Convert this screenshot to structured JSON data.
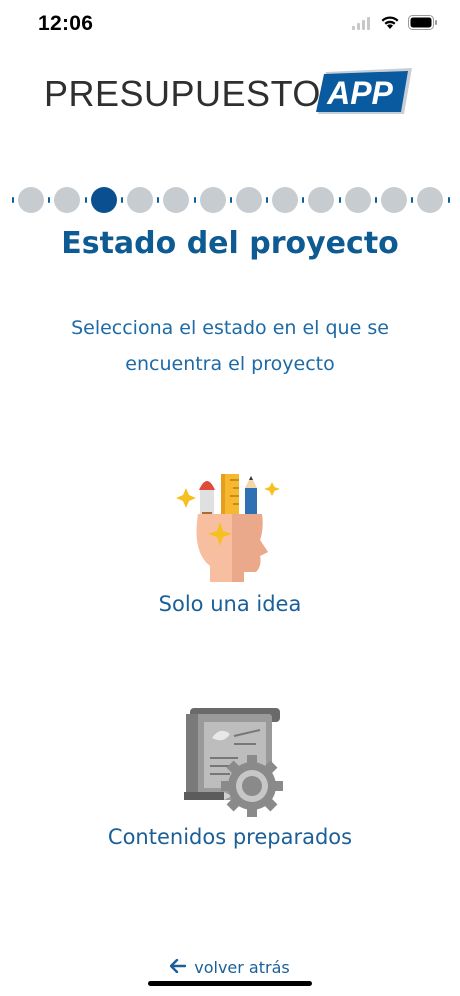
{
  "status_bar": {
    "time": "12:06",
    "icons": [
      "signal-icon",
      "wifi-icon",
      "battery-icon"
    ]
  },
  "logo": {
    "text_left": "PRESUPUESTO",
    "text_badge": "APP",
    "badge_color": "#0a5aa0"
  },
  "stepper": {
    "total_steps": 12,
    "current_step": 3,
    "active_color": "#0a4f8f",
    "inactive_color": "#c7ccd1"
  },
  "page": {
    "title": "Estado del proyecto",
    "subtitle": "Selecciona el estado en el que se encuentra el proyecto"
  },
  "options": [
    {
      "label": "Solo una idea",
      "icon": "head-with-ideas-icon"
    },
    {
      "label": "Contenidos preparados",
      "icon": "document-with-gear-icon"
    }
  ],
  "back": {
    "label": "volver atrás",
    "icon": "arrow-left-icon"
  }
}
